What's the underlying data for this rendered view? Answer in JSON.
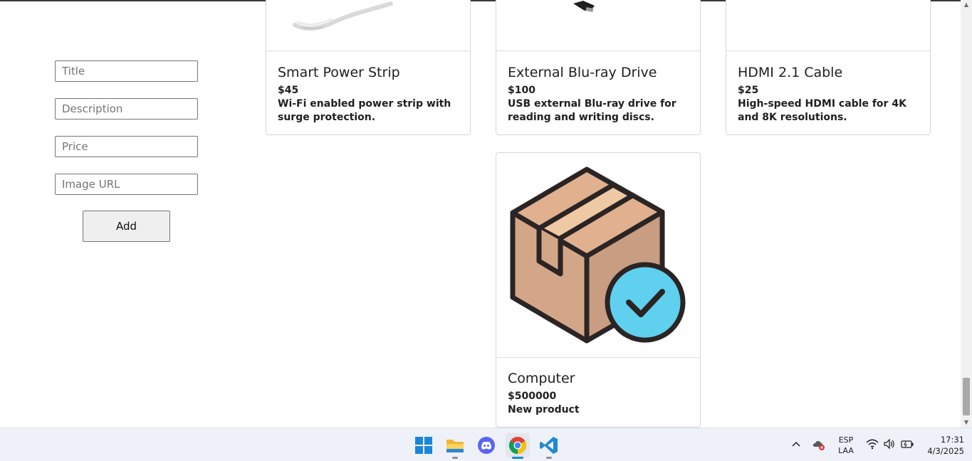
{
  "form": {
    "title_placeholder": "Title",
    "description_placeholder": "Description",
    "price_placeholder": "Price",
    "image_url_placeholder": "Image URL",
    "add_label": "Add"
  },
  "products": [
    {
      "title": "Smart Power Strip",
      "price": "$45",
      "description": "Wi-Fi enabled power strip with surge protection."
    },
    {
      "title": "External Blu-ray Drive",
      "price": "$100",
      "description": "USB external Blu-ray drive for reading and writing discs."
    },
    {
      "title": "HDMI 2.1 Cable",
      "price": "$25",
      "description": "High-speed HDMI cable for 4K and 8K resolutions."
    },
    {
      "title": "Computer",
      "price": "$500000",
      "description": "New product"
    }
  ],
  "taskbar": {
    "apps": [
      "windows-start-icon",
      "file-explorer-icon",
      "discord-icon",
      "chrome-icon",
      "vscode-icon"
    ],
    "language": "ESP",
    "layout": "LAA",
    "time": "17:31",
    "date": "4/3/2025"
  },
  "colors": {
    "accent": "#1a86d9",
    "box_body": "#d4a688",
    "box_tape": "#efc9a4",
    "check_circle": "#5fd0ee",
    "outline": "#2b2424"
  }
}
